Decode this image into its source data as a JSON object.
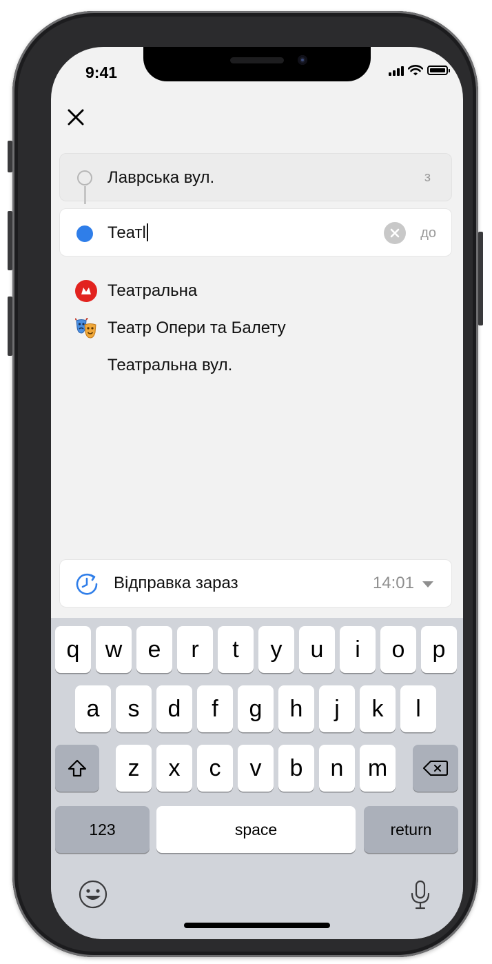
{
  "status_bar": {
    "time": "9:41"
  },
  "header": {
    "close_icon": "close-icon"
  },
  "route": {
    "from": {
      "value": "Лаврська вул.",
      "tag": "з"
    },
    "to": {
      "value": "Театl",
      "tag": "до"
    }
  },
  "suggestions": [
    {
      "icon": "metro-icon",
      "label": "Театральна"
    },
    {
      "icon": "theatre-masks-icon",
      "label": "Театр Опери та Балету"
    },
    {
      "icon": "",
      "label": "Театральна вул."
    }
  ],
  "departure": {
    "label": "Відправка зараз",
    "time": "14:01",
    "icon": "clock-icon"
  },
  "keyboard": {
    "row1": [
      "q",
      "w",
      "e",
      "r",
      "t",
      "y",
      "u",
      "i",
      "o",
      "p"
    ],
    "row2": [
      "a",
      "s",
      "d",
      "f",
      "g",
      "h",
      "j",
      "k",
      "l"
    ],
    "row3": [
      "z",
      "x",
      "c",
      "v",
      "b",
      "n",
      "m"
    ],
    "numbers_key": "123",
    "space_key": "space",
    "return_key": "return"
  },
  "colors": {
    "accent": "#2f7ee9",
    "metro": "#e2231f",
    "background": "#f2f2f2",
    "keyboard_bg": "#d1d4da"
  }
}
